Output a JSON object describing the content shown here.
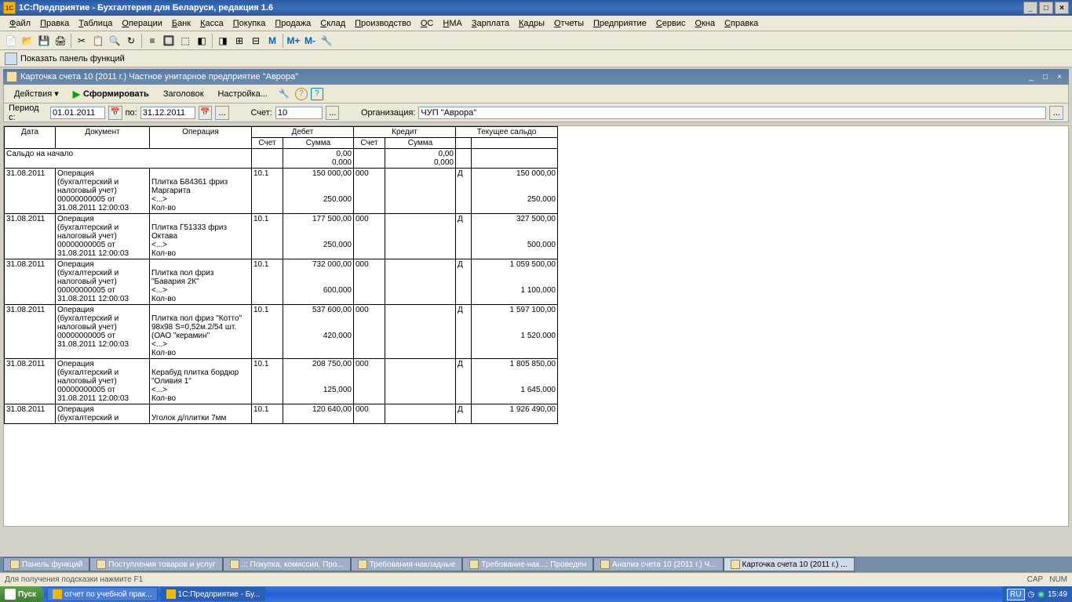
{
  "app_title": "1С:Предприятие - Бухгалтерия для Беларуси, редакция 1.6",
  "menubar": [
    "Файл",
    "Правка",
    "Таблица",
    "Операции",
    "Банк",
    "Касса",
    "Покупка",
    "Продажа",
    "Склад",
    "Производство",
    "ОС",
    "НМА",
    "Зарплата",
    "Кадры",
    "Отчеты",
    "Предприятие",
    "Сервис",
    "Окна",
    "Справка"
  ],
  "panel_functions_label": "Показать панель функций",
  "toolbar_icons": [
    "📄",
    "📂",
    "💾",
    "🖨",
    "✂",
    "📋",
    "🔍",
    "↻",
    "≡",
    "🔲",
    "⬚",
    "◧",
    "◨",
    "⊞",
    "⊟",
    "М",
    "М+",
    "М-",
    "🔧"
  ],
  "doc_title": "Карточка счета 10 (2011 г.) Частное унитарное предприятие \"Аврора\"",
  "doc_toolbar": {
    "actions_label": "Действия",
    "form_label": "Сформировать",
    "header_label": "Заголовок",
    "settings_label": "Настройка..."
  },
  "filter": {
    "period_from_label": "Период с:",
    "period_from": "01.01.2011",
    "period_to_label": "по:",
    "period_to": "31.12.2011",
    "account_label": "Счет:",
    "account": "10",
    "org_label": "Организация:",
    "org": "ЧУП \"Аврора\""
  },
  "chart_data": {
    "type": "table",
    "columns_top": [
      "Дата",
      "Документ",
      "Операция",
      "Дебет",
      "Кредит",
      "Текущее сальдо"
    ],
    "columns_sub": {
      "debit": [
        "Счет",
        "Сумма"
      ],
      "credit": [
        "Счет",
        "Сумма"
      ]
    },
    "opening_balance": {
      "label": "Сальдо на начало",
      "debit_sum": "0,00",
      "debit_qty": "0,000",
      "credit_sum": "0,00",
      "credit_qty": "0,000"
    },
    "rows": [
      {
        "date": "31.08.2011",
        "doc": "Операция (бухгалтерский и налоговый учет) 00000000005 от 31.08.2011 12:00:03",
        "op": "Плитка Б84361 фриз Маргарита\n<...>\nКол-во",
        "d_acc": "10.1",
        "d_sum": "150 000,00",
        "d_qty": "250,000",
        "c_acc": "000",
        "side": "Д",
        "bal": "150 000,00",
        "bal_qty": "250,000"
      },
      {
        "date": "31.08.2011",
        "doc": "Операция (бухгалтерский и налоговый учет) 00000000005 от 31.08.2011 12:00:03",
        "op": "Плитка Г51333 фриз Октава\n<...>\nКол-во",
        "d_acc": "10.1",
        "d_sum": "177 500,00",
        "d_qty": "250,000",
        "c_acc": "000",
        "side": "Д",
        "bal": "327 500,00",
        "bal_qty": "500,000"
      },
      {
        "date": "31.08.2011",
        "doc": "Операция (бухгалтерский и налоговый учет) 00000000005 от 31.08.2011 12:00:03",
        "op": "Плитка пол фриз \"Бавария 2К\"\n<...>\nКол-во",
        "d_acc": "10.1",
        "d_sum": "732 000,00",
        "d_qty": "600,000",
        "c_acc": "000",
        "side": "Д",
        "bal": "1 059 500,00",
        "bal_qty": "1 100,000"
      },
      {
        "date": "31.08.2011",
        "doc": "Операция (бухгалтерский и налоговый учет) 00000000005 от 31.08.2011 12:00:03",
        "op": "Плитка пол фриз \"Котто\" 98х98 S=0,52м.2/54 шт. (ОАО \"керамин\"\n<...>\nКол-во",
        "d_acc": "10.1",
        "d_sum": "537 600,00",
        "d_qty": "420,000",
        "c_acc": "000",
        "side": "Д",
        "bal": "1 597 100,00",
        "bal_qty": "1 520,000"
      },
      {
        "date": "31.08.2011",
        "doc": "Операция (бухгалтерский и налоговый учет) 00000000005 от 31.08.2011 12:00:03",
        "op": "Керабуд плитка бордюр \"Оливия 1\"\n<...>\nКол-во",
        "d_acc": "10.1",
        "d_sum": "208 750,00",
        "d_qty": "125,000",
        "c_acc": "000",
        "side": "Д",
        "bal": "1 805 850,00",
        "bal_qty": "1 645,000"
      },
      {
        "date": "31.08.2011",
        "doc": "Операция (бухгалтерский и",
        "op": "Уголок д/плитки 7мм",
        "d_acc": "10.1",
        "d_sum": "120 640,00",
        "d_qty": "",
        "c_acc": "000",
        "side": "Д",
        "bal": "1 926 490,00",
        "bal_qty": ""
      }
    ]
  },
  "window_tabs": [
    {
      "label": "Панель функций",
      "active": false
    },
    {
      "label": "Поступления товаров и услуг",
      "active": false
    },
    {
      "label": ".:: Покупка, комиссия. Про...",
      "active": false
    },
    {
      "label": "Требования-накладные",
      "active": false
    },
    {
      "label": "Требование-нак...: Проведен",
      "active": false
    },
    {
      "label": "Анализ счета 10 (2011 г.) Ч...",
      "active": false
    },
    {
      "label": "Карточка счета 10 (2011 г.) ...",
      "active": true
    }
  ],
  "statusbar": {
    "hint": "Для получения подсказки нажмите F1",
    "cap": "CAP",
    "num": "NUM"
  },
  "taskbar": {
    "start": "Пуск",
    "items": [
      {
        "label": "отчет по учебной прак...",
        "active": false
      },
      {
        "label": "1С:Предприятие - Бу...",
        "active": true
      }
    ],
    "tray": {
      "lang": "RU",
      "time": "15:49"
    }
  }
}
